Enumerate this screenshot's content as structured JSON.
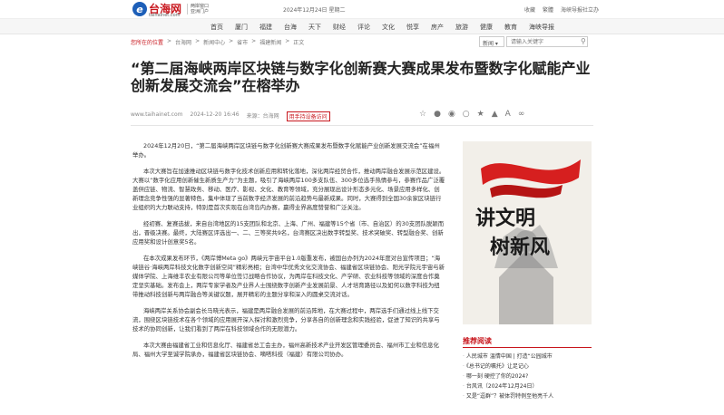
{
  "header": {
    "logo_mark": "e",
    "site_name": "台海网",
    "site_domain": "taihainet.com",
    "slogan_1": "两岸窗口",
    "slogan_2": "亚洲门户",
    "dateline": "2024年12月24日 星期二",
    "util_links": [
      "收藏",
      "繁體",
      "海峡导报社立办"
    ]
  },
  "nav": [
    "首页",
    "厦门",
    "福建",
    "台海",
    "天下",
    "财经",
    "评论",
    "文化",
    "悦享",
    "房产",
    "旅游",
    "健康",
    "教育",
    "海峡导报"
  ],
  "breadcrumb": [
    "您所在的位置",
    "台海网",
    "新闻中心",
    "省市",
    "福建新闻",
    "正文"
  ],
  "search": {
    "select_label": "新闻",
    "placeholder": "请输入关键字"
  },
  "article": {
    "title": "“第二届海峡两岸区块链与数字化创新赛大赛成果发布暨数字化赋能产业创新发展交流会”在榕举办",
    "meta": {
      "source_url": "www.taihainet.com",
      "datetime": "2024-12-20 16:46",
      "source": "来源：",
      "source_name": "台海网",
      "highlight": "用手持设备访问"
    },
    "paragraphs": [
      "2024年12月20日，“第二届海峡两岸区块链与数字化创新赛大赛成果发布暨数字化赋能产业创新发展交流会”在福州举办。",
      "本次大赛旨在加速推动区块链与数字化技术创新应用和转化落地，深化两岸经贸合作，推动两岸融合发展示范区建设。大赛以“数字化应用创新催生新质生产力”为主题，吸引了海峡两岸100多支队伍、300多位选手热情参与，参赛作品广泛覆盖供应链、物流、智慧政务、移动、医疗、影视、文化、教育等领域，充分展现出设计形态多元化、场景应用多样化、创新理念竞争性强的显著特色，集中体现了当前数字经济发展的前沿趋势与最新成果。同时，大赛得到全国30余家区块链行业组织的大力联动支持，特别是首次实现在台湾岛内办赛，赢得业界高度赞誉和广泛关注。",
      "经初赛、复赛选拔，来自台湾地区的15支团队和北京、上海、广州、福建等15个省（市、自治区）的30支团队脱颖而出，晋级决赛。最终，大陆赛区评选出一、二、三等奖共9名，台湾赛区决出数字转型奖、技术突破奖、转型融合奖、创新应用奖和设计创意奖5名。",
      "在本次成果发布环节，《两岸博Meta go》两峡元宇宙平台1.0版重发布，被国台办列为2024年度对台宣传项目；“海峡链谷·海峡两岸科技文化数字创新空间”精彩亮相；台湾中华优秀文化交流协会、福建省区块链协会、阳光学院元宇宙与新媒体学院、上海维丰农业有限公司等单位签订战略合作协议，为两岸在科技文化、产学研、农业科技等领域的深度合作奠定坚实基础。发布会上，两岸专家学者及产业界人士围绕数字创新产业发展前景、人才培育路径以及如何以数字科技为纽带推动科技创新与两岸融合等关键议题，展开精彩的主题分享和深入的圆桌交流对话。",
      "海峡两岸关系协会副会长马晓光表示，福建是两岸融合发展的前沿阵地，在大赛过程中，两岸选手们通过线上线下交流，围绕区块链技术在各个领域的应用展开深入探讨和激烈竞争，分享各自的创新理念和实践经验，促进了知识的共享与技术的协同创新，让我们看到了两岸在科技领域合作的无限潜力。",
      "本次大赛由福建省工业和信息化厅、福建省总工会主办，福州高新技术产业开发区管理委员会、福州市工业和信息化局、福州大学至诚学院承办，福建省区块链协会、嘀嗒科技（福建）有限公司协办。"
    ]
  },
  "sidebar": {
    "ad_text_1": "讲文明",
    "ad_text_2": "树新风",
    "recommend_title": "推荐阅读",
    "recommend_items": [
      "人民城市 温情中国 | 打造“公园城市",
      "《总书记的嘱托》让足记心",
      "哪一刻 硬控了你的2024?",
      "台风讯（2024年12月24日）",
      "又是“逗群”？被体罚特例至他亮千人"
    ]
  }
}
